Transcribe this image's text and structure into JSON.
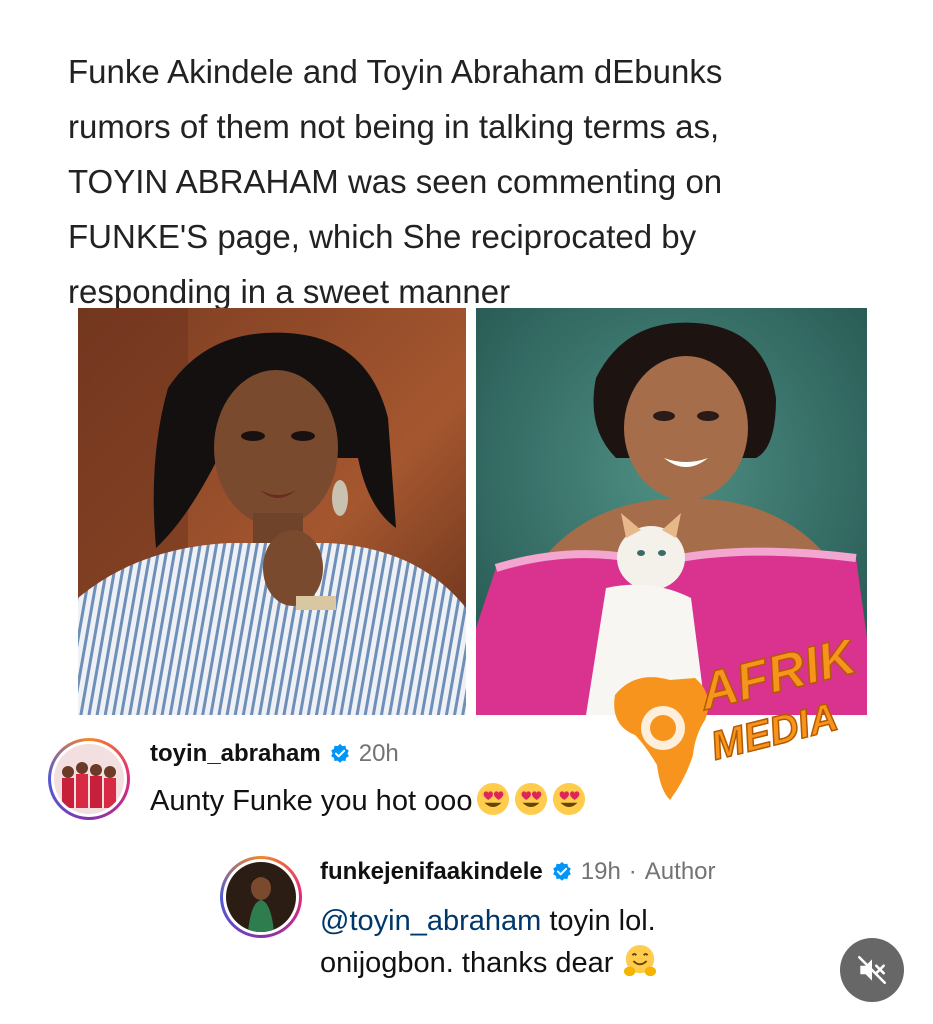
{
  "post": {
    "headline_lines": [
      "Funke Akindele and Toyin Abraham dEbunks",
      "rumors of them not being in talking terms as,",
      "TOYIN ABRAHAM was seen commenting on",
      "FUNKE'S page, which She reciprocated by",
      "responding in a sweet manner"
    ]
  },
  "watermark": {
    "line1": "AFRIK",
    "line2": "MEDIA",
    "color": "#f7941d"
  },
  "comments": [
    {
      "username": "toyin_abraham",
      "time": "20h",
      "text": "Aunty Funke you hot ooo",
      "emojis": [
        "heart-eyes-emoji",
        "heart-eyes-emoji",
        "heart-eyes-emoji"
      ]
    },
    {
      "username": "funkejenifaakindele",
      "time": "19h",
      "separator": "·",
      "badge": "Author",
      "mention": "@toyin_abraham",
      "text_line1": "toyin lol.",
      "text_line2": "onijogbon. thanks dear",
      "emojis": [
        "hugging-face-emoji"
      ]
    }
  ],
  "controls": {
    "mute_icon": "speaker-muted-icon"
  },
  "colors": {
    "verified": "#0095f6",
    "mention": "#00376b",
    "muted_text": "#737373"
  }
}
